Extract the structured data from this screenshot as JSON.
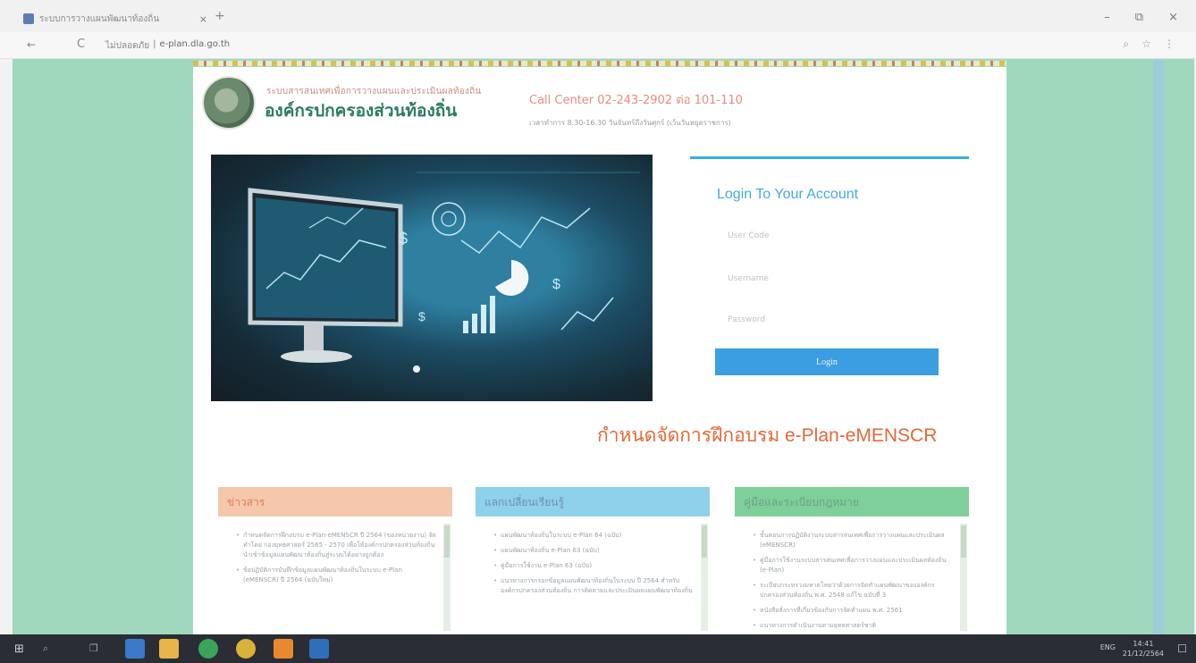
{
  "browser": {
    "tab_title": "ระบบการวางแผนพัฒนาท้องถิ่น",
    "tab_close": "×",
    "new_tab": "+",
    "back": "←",
    "reload": "C",
    "url_warning": "ไม่ปลอดภัย",
    "url_separator": "|",
    "url_host": "e-plan.dla.go.th",
    "window": {
      "minimize": "–",
      "restore": "⧉",
      "close": "×"
    },
    "tools": [
      "⌕",
      "☆",
      "⋮"
    ]
  },
  "header": {
    "org_thai_tagline": "ระบบสารสนเทศเพื่อการวางแผนและประเมินผลท้องถิ่น",
    "org_name": "องค์กรปกครองส่วนท้องถิ่น",
    "call_center": "Call Center 02-243-2902 ต่อ 101-110",
    "hours": "เวลาทำการ 8.30-16.30 วันจันทร์ถึงวันศุกร์ (เว้นวันหยุดราชการ)"
  },
  "login": {
    "title": "Login To Your Account",
    "user_placeholder": "User Code",
    "username_placeholder": "Username",
    "password_placeholder": "Password",
    "button": "Login"
  },
  "training_heading": "กำหนดจัดการฝึกอบรม e-Plan-eMENSCR",
  "columns": [
    {
      "title": "ข่าวสาร",
      "items": [
        "กำหนดจัดการฝึกอบรม e-Plan-eMENSCR ปี 2564 (ของหน่วยงาน) จัดทำโดย กองยุทธศาสตร์ 2565 - 2570 เพื่อให้องค์กรปกครองส่วนท้องถิ่นนำเข้าข้อมูลแผนพัฒนาท้องถิ่นสู่ระบบได้อย่างถูกต้อง",
        "ข้อปฏิบัติการบันทึกข้อมูลแผนพัฒนาท้องถิ่นในระบบ e-Plan (eMENSCR) ปี 2564 (ฉบับใหม่)"
      ]
    },
    {
      "title": "แลกเปลี่ยนเรียนรู้",
      "items": [
        "แผนพัฒนาท้องถิ่นในระบบ e-Plan 64 (ฉบับ)",
        "แผนพัฒนาท้องถิ่น e-Plan 63 (ฉบับ)",
        "คู่มือการใช้งาน e-Plan 63 (ฉบับ)",
        "แนวทางการกรอกข้อมูลแผนพัฒนาท้องถิ่นในระบบ ปี 2564 สำหรับองค์กรปกครองส่วนท้องถิ่น การติดตามและประเมินผลแผนพัฒนาท้องถิ่น"
      ]
    },
    {
      "title": "คู่มือและระเบียบกฎหมาย",
      "items": [
        "ขั้นตอนการปฏิบัติงานระบบสารสนเทศเพื่อการวางแผนและประเมินผล (eMENSCR)",
        "คู่มือการใช้งานระบบสารสนเทศเพื่อการวางแผนและประเมินผลท้องถิ่น (e-Plan)",
        "ระเบียบกระทรวงมหาดไทยว่าด้วยการจัดทำแผนพัฒนาขององค์กรปกครองส่วนท้องถิ่น พ.ศ. 2548 แก้ไข ฉบับที่ 3",
        "หนังสือสั่งการที่เกี่ยวข้องกับการจัดทำแผน พ.ศ. 2561",
        "แนวทางการดำเนินงานตามยุทธศาสตร์ชาติ"
      ]
    }
  ],
  "taskbar": {
    "start": "⊞",
    "search": "⌕",
    "task_view": "❐",
    "tray_lang": "ENG",
    "time": "14:41",
    "date": "21/12/2564",
    "notifications": "☐"
  },
  "colors": {
    "page_bg": "#9fd8bd",
    "login_title": "#47a9da",
    "login_button": "#3a9ee0",
    "training_heading": "#e2683a",
    "news_header": "#f5c8ad",
    "learn_header": "#8fd0ea",
    "law_header": "#7ecf9a"
  },
  "icons": {
    "logo": "dla-seal",
    "slideshow_indicator": "dot"
  }
}
